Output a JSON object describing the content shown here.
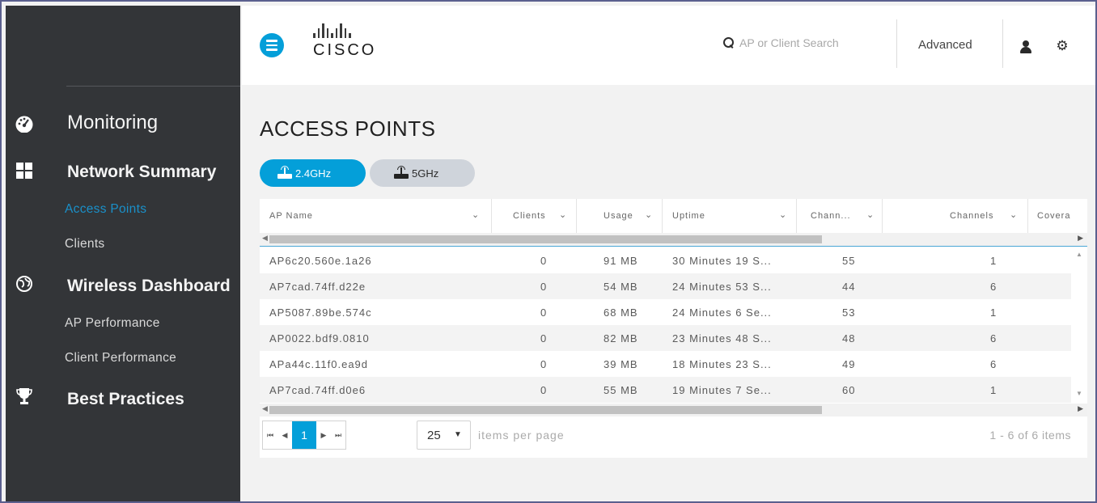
{
  "sidebar": {
    "sections": [
      {
        "label": "Monitoring",
        "icon": "dashboard-gauge-icon"
      },
      {
        "label": "Network Summary",
        "icon": "grid-icon"
      },
      {
        "label": "Wireless Dashboard",
        "icon": "globe-icon"
      },
      {
        "label": "Best Practices",
        "icon": "trophy-icon"
      }
    ],
    "subitems": [
      {
        "label": "Access Points",
        "active": true
      },
      {
        "label": "Clients",
        "active": false
      },
      {
        "label": "AP Performance",
        "active": false
      },
      {
        "label": "Client Performance",
        "active": false
      }
    ]
  },
  "header": {
    "logo_text": "CISCO",
    "search_placeholder": "AP or Client Search",
    "advanced_label": "Advanced"
  },
  "main": {
    "title": "ACCESS POINTS",
    "bands": [
      {
        "label": "2.4GHz",
        "selected": true
      },
      {
        "label": "5GHz",
        "selected": false
      }
    ],
    "table": {
      "columns": [
        "AP Name",
        "Clients",
        "Usage",
        "Uptime",
        "Chann...",
        "Channels",
        "Covera"
      ],
      "rows": [
        [
          "AP6c20.560e.1a26",
          "0",
          "91 MB",
          "30 Minutes 19 S...",
          "55",
          "1"
        ],
        [
          "AP7cad.74ff.d22e",
          "0",
          "54 MB",
          "24 Minutes 53 S...",
          "44",
          "6"
        ],
        [
          "AP5087.89be.574c",
          "0",
          "68 MB",
          "24 Minutes 6 Se...",
          "53",
          "1"
        ],
        [
          "AP0022.bdf9.0810",
          "0",
          "82 MB",
          "23 Minutes 48 S...",
          "48",
          "6"
        ],
        [
          "APa44c.11f0.ea9d",
          "0",
          "39 MB",
          "18 Minutes 23 S...",
          "49",
          "6"
        ],
        [
          "AP7cad.74ff.d0e6",
          "0",
          "55 MB",
          "19 Minutes 7 Se...",
          "60",
          "1"
        ]
      ]
    },
    "pager": {
      "current_page": "1",
      "page_size": "25",
      "items_per_page_label": "items per page",
      "count_label": "1 - 6 of 6 items"
    }
  },
  "colors": {
    "accent": "#049fd9",
    "sidebar_bg": "#333538",
    "active_nav": "#1a90c9"
  }
}
